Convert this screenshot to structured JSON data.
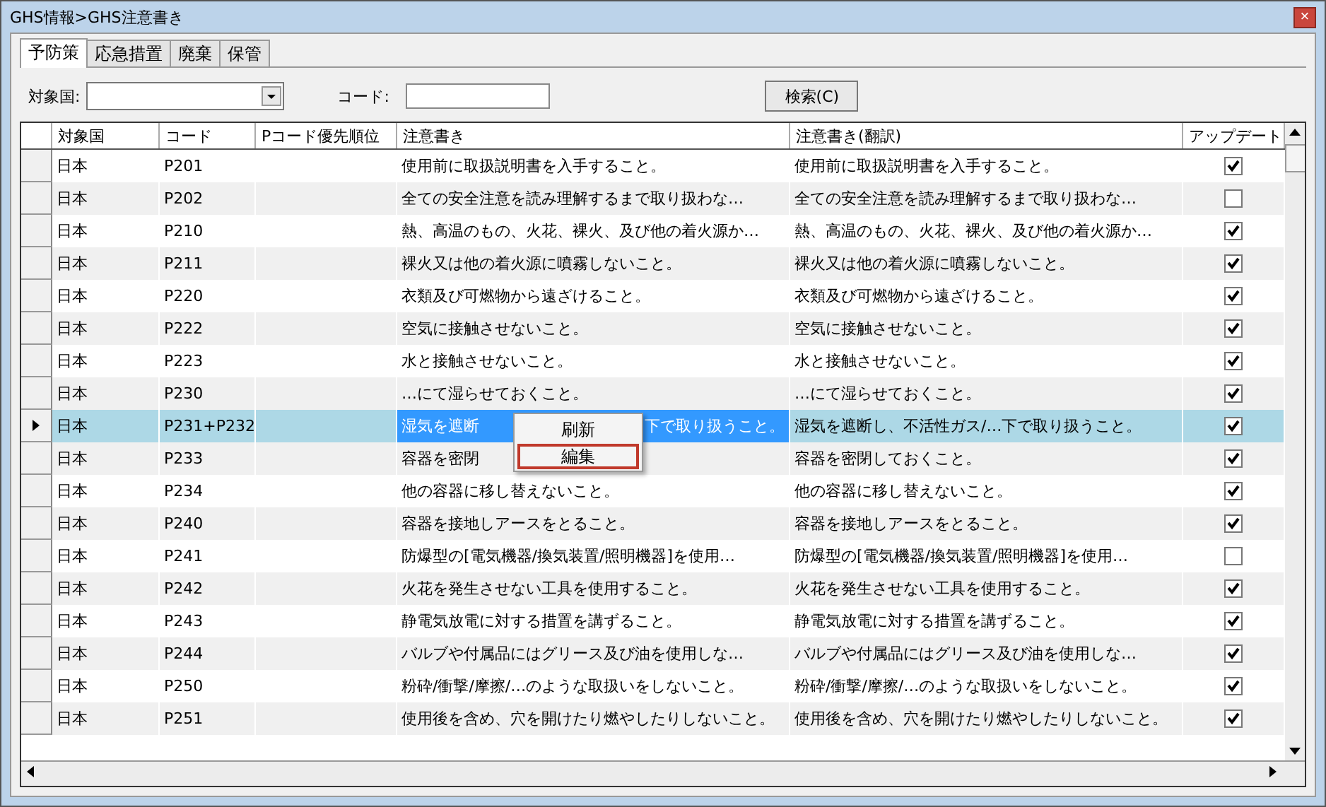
{
  "window": {
    "title": "GHS情報>GHS注意書き",
    "close_glyph": "×"
  },
  "tabs": [
    {
      "label": "予防策",
      "selected": true
    },
    {
      "label": "応急措置",
      "selected": false
    },
    {
      "label": "廃棄",
      "selected": false
    },
    {
      "label": "保管",
      "selected": false
    }
  ],
  "filters": {
    "country_label": "対象国:",
    "code_label": "コード:",
    "search_button": "検索(C)"
  },
  "table": {
    "columns": [
      "対象国",
      "コード",
      "Pコード優先順位",
      "注意書き",
      "注意書き(翻訳)",
      "アップデート"
    ],
    "rows": [
      {
        "country": "日本",
        "code": "P201",
        "note": "使用前に取扱説明書を入手すること。",
        "translation": "使用前に取扱説明書を入手すること。",
        "update": true,
        "selected": false
      },
      {
        "country": "日本",
        "code": "P202",
        "note": "全ての安全注意を読み理解するまで取り扱わな…",
        "translation": "全ての安全注意を読み理解するまで取り扱わな…",
        "update": false,
        "selected": false
      },
      {
        "country": "日本",
        "code": "P210",
        "note": "熱、高温のもの、火花、裸火、及び他の着火源か…",
        "translation": "熱、高温のもの、火花、裸火、及び他の着火源か…",
        "update": true,
        "selected": false
      },
      {
        "country": "日本",
        "code": "P211",
        "note": "裸火又は他の着火源に噴霧しないこと。",
        "translation": "裸火又は他の着火源に噴霧しないこと。",
        "update": true,
        "selected": false
      },
      {
        "country": "日本",
        "code": "P220",
        "note": "衣類及び可燃物から遠ざけること。",
        "translation": "衣類及び可燃物から遠ざけること。",
        "update": true,
        "selected": false
      },
      {
        "country": "日本",
        "code": "P222",
        "note": "空気に接触させないこと。",
        "translation": "空気に接触させないこと。",
        "update": true,
        "selected": false
      },
      {
        "country": "日本",
        "code": "P223",
        "note": "水と接触させないこと。",
        "translation": "水と接触させないこと。",
        "update": true,
        "selected": false
      },
      {
        "country": "日本",
        "code": "P230",
        "note": "…にて湿らせておくこと。",
        "translation": "…にて湿らせておくこと。",
        "update": true,
        "selected": false
      },
      {
        "country": "日本",
        "code": "P231+P232",
        "note": "湿気を遮断",
        "note_after_menu": "下で取り扱うこと。",
        "translation": "湿気を遮断し、不活性ガス/…下で取り扱うこと。",
        "update": true,
        "selected": true
      },
      {
        "country": "日本",
        "code": "P233",
        "note": "容器を密閉",
        "translation": "容器を密閉しておくこと。",
        "update": true,
        "selected": false
      },
      {
        "country": "日本",
        "code": "P234",
        "note": "他の容器に移し替えないこと。",
        "translation": "他の容器に移し替えないこと。",
        "update": true,
        "selected": false
      },
      {
        "country": "日本",
        "code": "P240",
        "note": "容器を接地しアースをとること。",
        "translation": "容器を接地しアースをとること。",
        "update": true,
        "selected": false
      },
      {
        "country": "日本",
        "code": "P241",
        "note": "防爆型の[電気機器/換気装置/照明機器]を使用…",
        "translation": "防爆型の[電気機器/換気装置/照明機器]を使用…",
        "update": false,
        "selected": false
      },
      {
        "country": "日本",
        "code": "P242",
        "note": "火花を発生させない工具を使用すること。",
        "translation": "火花を発生させない工具を使用すること。",
        "update": true,
        "selected": false
      },
      {
        "country": "日本",
        "code": "P243",
        "note": "静電気放電に対する措置を講ずること。",
        "translation": "静電気放電に対する措置を講ずること。",
        "update": true,
        "selected": false
      },
      {
        "country": "日本",
        "code": "P244",
        "note": "バルブや付属品にはグリース及び油を使用しな…",
        "translation": "バルブや付属品にはグリース及び油を使用しな…",
        "update": true,
        "selected": false
      },
      {
        "country": "日本",
        "code": "P250",
        "note": "粉砕/衝撃/摩擦/…のような取扱いをしないこと。",
        "translation": "粉砕/衝撃/摩擦/…のような取扱いをしないこと。",
        "update": true,
        "selected": false
      },
      {
        "country": "日本",
        "code": "P251",
        "note": "使用後を含め、穴を開けたり燃やしたりしないこと。",
        "translation": "使用後を含め、穴を開けたり燃やしたりしないこと。",
        "update": true,
        "selected": false
      }
    ]
  },
  "context_menu": {
    "items": [
      {
        "label": "刷新",
        "selected": false
      },
      {
        "label": "編集",
        "selected": true
      }
    ]
  }
}
